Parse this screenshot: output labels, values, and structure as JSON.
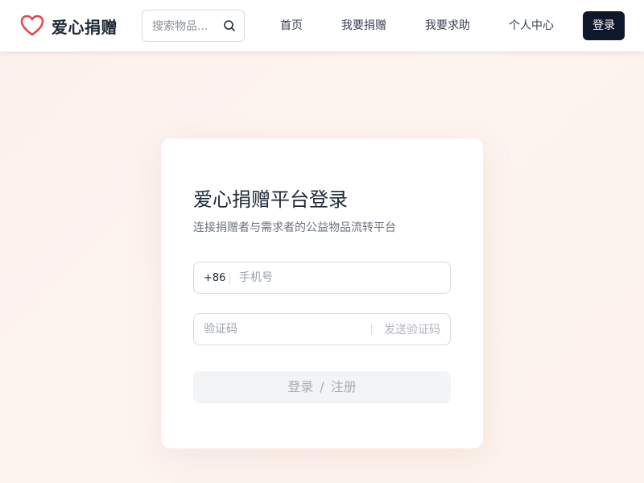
{
  "header": {
    "brand_name": "爱心捐赠",
    "logo_icon": "heart-outline-icon",
    "accent_color": "#e5484d",
    "search": {
      "placeholder": "搜索物品...",
      "icon": "search-icon"
    },
    "nav": {
      "home": "首页",
      "donate": "我要捐赠",
      "help": "我要求助",
      "profile": "个人中心"
    },
    "login_button": "登录",
    "login_button_color": "#0f172a"
  },
  "login_card": {
    "title": "爱心捐赠平台登录",
    "subtitle": "连接捐赠者与需求者的公益物品流转平台",
    "phone": {
      "country_code": "+86",
      "placeholder": "手机号",
      "value": ""
    },
    "code": {
      "placeholder": "验证码",
      "value": "",
      "send_label": "发送验证码"
    },
    "submit": {
      "login_label": "登录",
      "separator": "/",
      "register_label": "注册",
      "state": "disabled"
    }
  }
}
